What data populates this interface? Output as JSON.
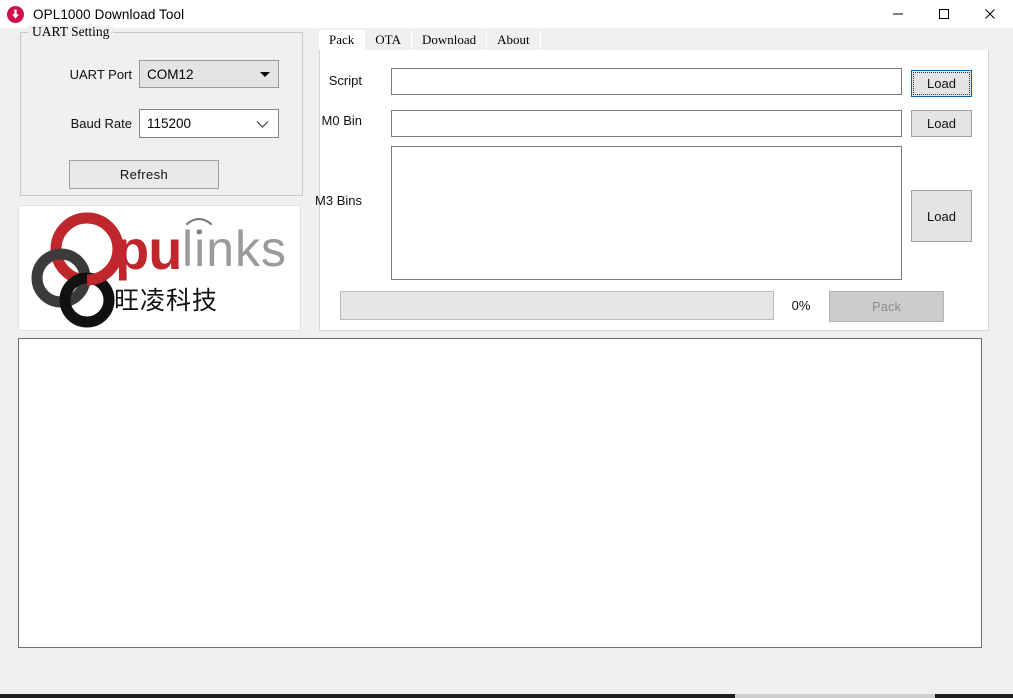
{
  "window": {
    "title": "OPL1000 Download Tool",
    "app_icon": "download-circle-icon",
    "minimize_label": "—",
    "maximize_label": "☐",
    "close_label": "✕"
  },
  "uart_setting": {
    "group_title": "UART Setting",
    "port_label": "UART Port",
    "port_value": "COM12",
    "baud_label": "Baud Rate",
    "baud_value": "115200",
    "refresh_label": "Refresh"
  },
  "logo": {
    "brand_red": "Opu",
    "brand_gray": "links",
    "brand_cn": "旺凌科技",
    "color_red": "#c0272d",
    "color_dark": "#3b3b3b",
    "color_black": "#111111",
    "color_gray": "#9a9a9a"
  },
  "tabs": [
    {
      "label": "Pack",
      "active": true
    },
    {
      "label": "OTA",
      "active": false
    },
    {
      "label": "Download",
      "active": false
    },
    {
      "label": "About",
      "active": false
    }
  ],
  "pack_tab": {
    "script_label": "Script",
    "script_value": "",
    "script_load_label": "Load",
    "m0bin_label": "M0 Bin",
    "m0bin_value": "",
    "m0bin_load_label": "Load",
    "m3bins_label": "M3 Bins",
    "m3bins_items": [],
    "m3bins_load_label": "Load",
    "progress_percent": "0%",
    "progress_value": 0,
    "pack_label": "Pack"
  },
  "log": {
    "content": ""
  }
}
